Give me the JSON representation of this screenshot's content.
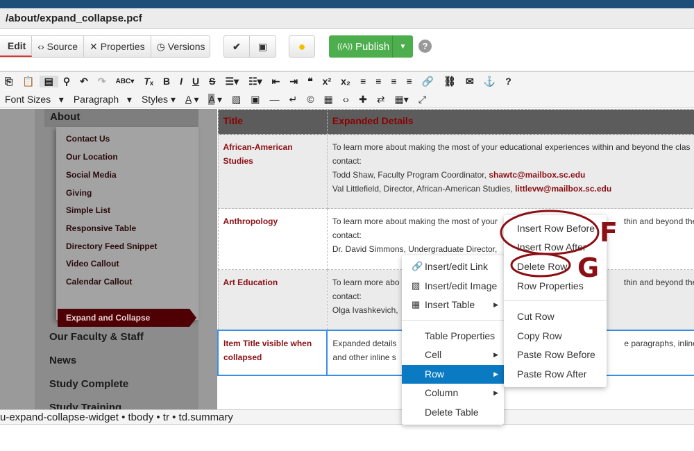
{
  "window": {
    "path": "/about/expand_collapse.pcf"
  },
  "tabs": [
    {
      "label": "Edit"
    },
    {
      "label": "Source"
    },
    {
      "label": "Properties"
    },
    {
      "label": "Versions"
    }
  ],
  "actions": {
    "publish": "Publish",
    "help": "?"
  },
  "editor_toolbar": {
    "font_sizes": "Font Sizes",
    "paragraph": "Paragraph",
    "styles": "Styles"
  },
  "sidebar": {
    "section": "About",
    "items": [
      "Contact Us",
      "Our Location",
      "Social Media",
      "Giving",
      "Simple List",
      "Responsive Table",
      "Directory Feed Snippet",
      "Video Callout",
      "Calendar Callout"
    ],
    "active": "Expand and Collapse",
    "top_items": [
      "Our Faculty & Staff",
      "News",
      "Study Complete",
      "Study Training"
    ]
  },
  "table": {
    "headers": [
      "Title",
      "Expanded Details"
    ],
    "rows": [
      {
        "title": "African-American Studies",
        "lines": [
          "To learn more about making the most of your educational experiences within and beyond the clas",
          "contact:"
        ],
        "contacts": [
          {
            "text": "Todd Shaw, Faculty Program Coordinator, ",
            "email": "shawtc@mailbox.sc.edu"
          },
          {
            "text": "Val Littlefield, Director, African-American Studies, ",
            "email": "littlevw@mailbox.sc.edu"
          }
        ]
      },
      {
        "title": "Anthropology",
        "lines": [
          "To learn more about making the most of your",
          "contact:",
          "Dr. David Simmons, Undergraduate Director,"
        ],
        "tail": "thin and beyond the clas"
      },
      {
        "title": "Art Education",
        "lines": [
          "To learn more abo",
          "contact:",
          "Olga Ivashkevich,"
        ],
        "tail": "thin and beyond the clas"
      },
      {
        "title": "Item Title visible when collapsed",
        "lines": [
          "Expanded details",
          "and other inline s"
        ],
        "tail": "e paragraphs, inline link"
      }
    ]
  },
  "status_bar": {
    "path": "u-expand-collapse-widget • tbody • tr • td.summary"
  },
  "context_menu": {
    "items": [
      "Insert/edit Link",
      "Insert/edit Image",
      "Insert Table",
      "Table Properties",
      "Cell",
      "Row",
      "Column",
      "Delete Table"
    ],
    "highlighted": "Row"
  },
  "row_submenu": {
    "items": [
      "Insert Row Before",
      "Insert Row After",
      "Delete Row",
      "Row Properties",
      "Cut Row",
      "Copy Row",
      "Paste Row Before",
      "Paste Row After"
    ]
  },
  "annotations": {
    "f": "F",
    "g": "G"
  },
  "colors": {
    "accent": "#8b0f14",
    "publish": "#4cae4c",
    "highlight": "#0a7ac2"
  }
}
